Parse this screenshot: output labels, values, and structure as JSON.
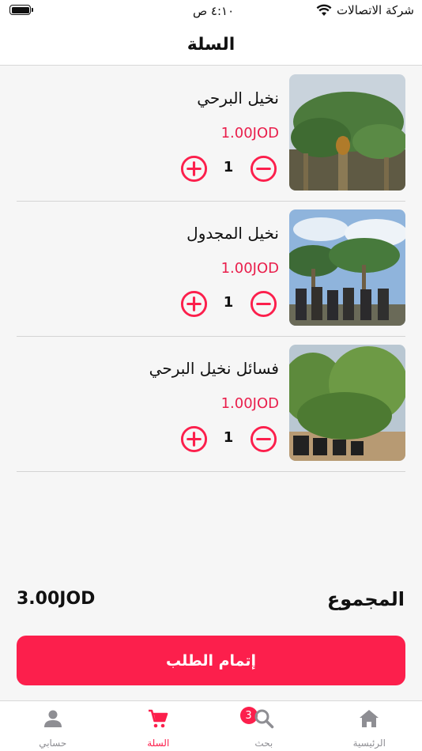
{
  "status_bar": {
    "time": "٤:١٠ ص",
    "carrier": "شركة الاتصالات",
    "icons": [
      "battery-icon",
      "wifi-icon"
    ]
  },
  "header": {
    "title": "السلة"
  },
  "cart": {
    "items": [
      {
        "name": "نخيل البرحي",
        "price": "1.00JOD",
        "quantity": "1"
      },
      {
        "name": "نخيل المجدول",
        "price": "1.00JOD",
        "quantity": "1"
      },
      {
        "name": "فسائل نخيل البرحي",
        "price": "1.00JOD",
        "quantity": "1"
      }
    ]
  },
  "summary": {
    "total_label": "المجموع",
    "total_value": "3.00JOD"
  },
  "checkout": {
    "label": "إتمام الطلب"
  },
  "tab_bar": {
    "tabs": [
      {
        "label": "حسابي",
        "icon": "person-icon"
      },
      {
        "label": "السلة",
        "icon": "cart-icon",
        "badge": "3"
      },
      {
        "label": "بحث",
        "icon": "search-icon"
      },
      {
        "label": "الرئيسية",
        "icon": "home-icon"
      }
    ]
  },
  "colors": {
    "accent": "#fc1f4c",
    "price": "#e91e4b",
    "inactive": "#8e8e93"
  }
}
